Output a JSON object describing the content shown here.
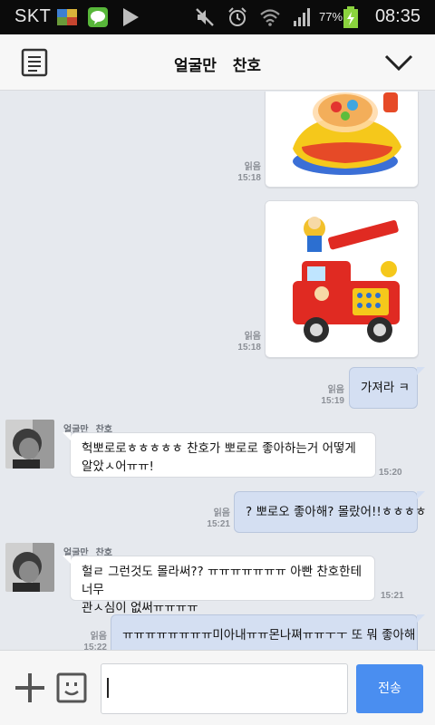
{
  "status_bar": {
    "carrier": "SKT",
    "battery": "77%",
    "time": "08:35",
    "icons": [
      "gallery-icon",
      "line-app-icon",
      "play-store-icon",
      "mute-icon",
      "alarm-icon",
      "wifi-icon",
      "signal-icon",
      "battery-charging-icon"
    ]
  },
  "header": {
    "title": "얼굴만   찬호",
    "menu_icon": "note-icon",
    "collapse_icon": "chevron-down-icon"
  },
  "messages": {
    "img1": {
      "read": "읽음",
      "time": "15:18",
      "picture": "toy-ufo-photo"
    },
    "img2": {
      "read": "읽음",
      "time": "15:18",
      "picture": "toy-fire-truck-photo"
    },
    "out1": {
      "text": "가져라 ㅋ",
      "read": "읽음",
      "time": "15:19"
    },
    "in1": {
      "sender_a": "얼굴만",
      "sender_b": "찬호",
      "line1": "헉뽀로로ㅎㅎㅎㅎㅎ 찬호가 뽀로로 좋아하는거 어떻게",
      "line2": "알았ㅅ어ㅠㅠ!",
      "time": "15:20"
    },
    "out2": {
      "text": "? 뽀로오 좋아해? 몰랐어!!ㅎㅎㅎㅎ",
      "read": "읽음",
      "time": "15:21"
    },
    "in2": {
      "sender_a": "얼굴만",
      "sender_b": "찬호",
      "line1": "헐ㄹ 그런것도 몰라써?? ㅠㅠㅠㅠㅠㅠㅠ 아빤 찬호한테 너무",
      "line2": "관ㅅ심이 없써ㅠㅠㅠㅠ",
      "time": "15:21"
    },
    "out3": {
      "text": "ㅠㅠㅠㅠㅠㅠㅠㅠ미아내ㅠㅠ몬나쪄ㅠㅠㅜㅜ 또 뭐 좋아해",
      "read": "읽음",
      "time": "15:22"
    }
  },
  "input_bar": {
    "plus_icon": "plus-icon",
    "emoji_icon": "emoticon-icon",
    "value": "",
    "send_label": "전송"
  },
  "colors": {
    "send_button": "#4a8ef0",
    "outgoing_bubble": "#d4dff2",
    "chat_background": "#e6e9ee"
  }
}
